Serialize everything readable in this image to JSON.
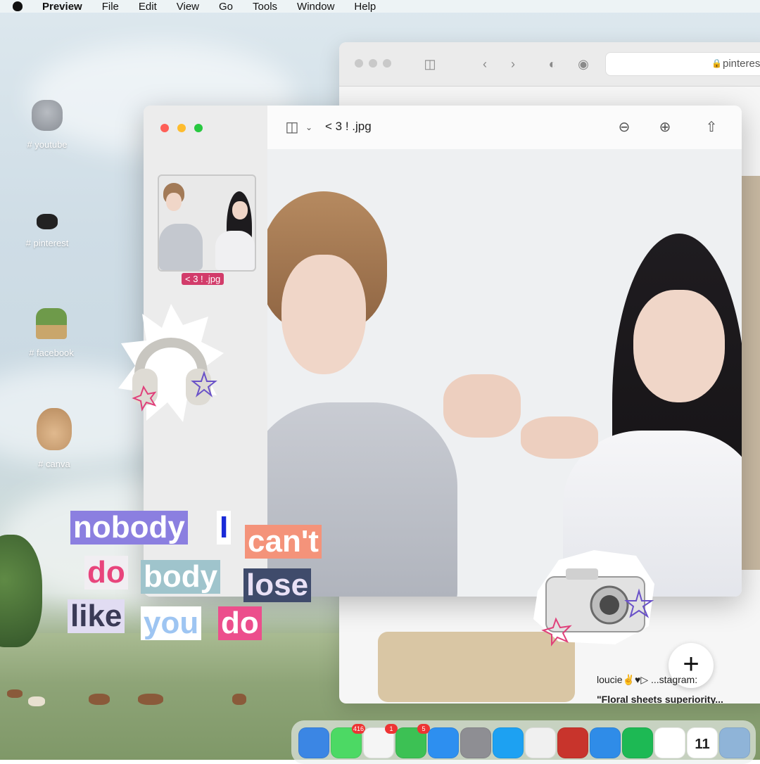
{
  "menubar": {
    "app_name": "Preview",
    "items": [
      "File",
      "Edit",
      "View",
      "Go",
      "Tools",
      "Window",
      "Help"
    ]
  },
  "desktop_icons": [
    {
      "label": "# youtube",
      "icon": "teddy-bear-icon"
    },
    {
      "label": "# pinterest",
      "icon": "shoes-icon"
    },
    {
      "label": "# facebook",
      "icon": "plant-icon"
    },
    {
      "label": "# canva",
      "icon": "bunny-icon"
    }
  ],
  "safari": {
    "url_text": "pinteres",
    "pin_author": "loucie✌♥▷ ...stagram:",
    "pin_title": "\"Floral sheets superiority...",
    "plus_label": "+"
  },
  "preview": {
    "title": "< 3 ! .jpg",
    "thumbnail_label": "< 3 ! .jpg"
  },
  "lyrics": [
    {
      "text": "nobody",
      "bg": "#8b7fe0",
      "fg": "#ffffff"
    },
    {
      "text": "I",
      "bg": "#ffffff",
      "fg": "#1a2bd8"
    },
    {
      "text": "can't",
      "bg": "#f4937a",
      "fg": "#ffffff"
    },
    {
      "text": "do",
      "bg": "#f1eef2",
      "fg": "#e8447c"
    },
    {
      "text": "body",
      "bg": "#9fc4cc",
      "fg": "#ffffff"
    },
    {
      "text": "lose",
      "bg": "#3f4b6b",
      "fg": "#e9e1f6"
    },
    {
      "text": "like",
      "bg": "#e1dcf2",
      "fg": "#3a3a56"
    },
    {
      "text": "you",
      "bg": "#ffffff",
      "fg": "#9ec5f2"
    },
    {
      "text": "do",
      "bg": "#ec4e8c",
      "fg": "#ffffff"
    }
  ],
  "dock": {
    "apps": [
      {
        "name": "finder-icon",
        "color": "#3b86e4"
      },
      {
        "name": "messages-icon",
        "color": "#4cd964",
        "badge": "416"
      },
      {
        "name": "photos-icon",
        "color": "#f5f5f5",
        "badge": "1"
      },
      {
        "name": "facetime-icon",
        "color": "#3cc154",
        "badge": "5"
      },
      {
        "name": "app-store-icon",
        "color": "#2d8ff0"
      },
      {
        "name": "settings-icon",
        "color": "#8e8e93"
      },
      {
        "name": "twitter-icon",
        "color": "#1da1f2"
      },
      {
        "name": "chrome-icon",
        "color": "#f0f0f0"
      },
      {
        "name": "photo-booth-icon",
        "color": "#c8342c"
      },
      {
        "name": "safari-icon",
        "color": "#2f8ce8"
      },
      {
        "name": "spotify-icon",
        "color": "#1db954"
      },
      {
        "name": "notion-icon",
        "color": "#ffffff"
      },
      {
        "name": "calendar-icon",
        "color": "#ffffff",
        "text": "11"
      },
      {
        "name": "preview-icon",
        "color": "#8fb4d8"
      }
    ]
  }
}
